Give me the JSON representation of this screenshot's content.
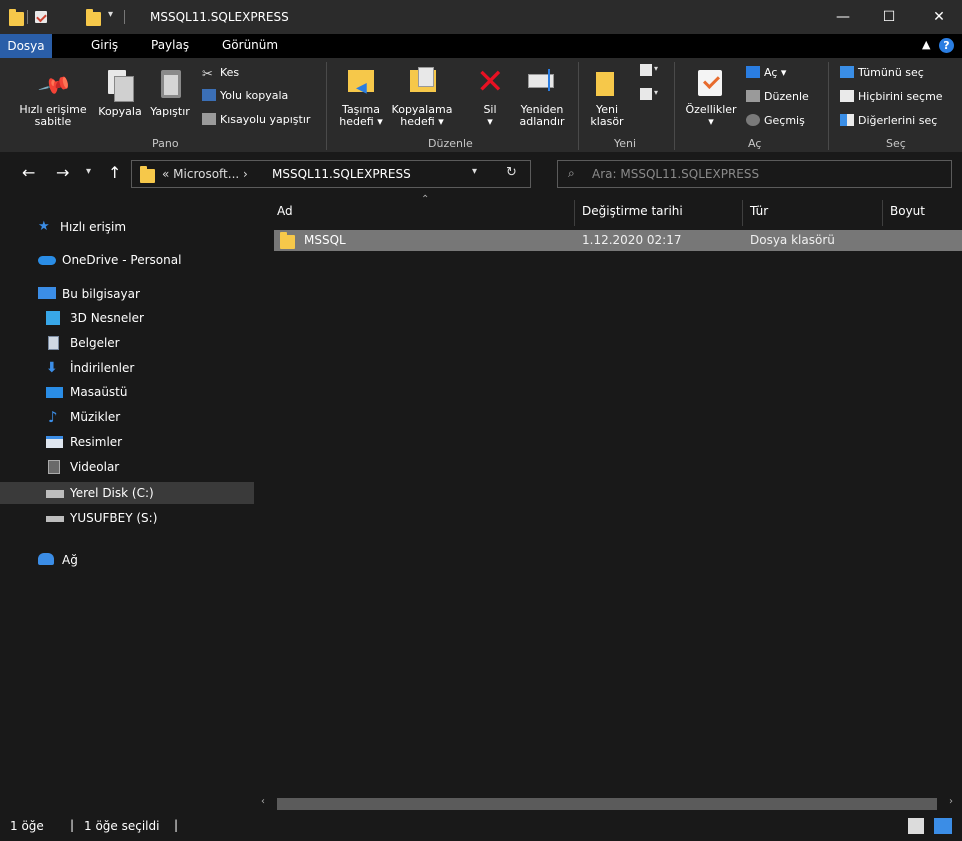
{
  "window": {
    "title": "MSSQL11.SQLEXPRESS",
    "controls": {
      "minimize": "—",
      "maximize": "☐",
      "close": "✕"
    }
  },
  "menu": {
    "tabs": [
      "Dosya",
      "Giriş",
      "Paylaş",
      "Görünüm"
    ],
    "active": "Dosya"
  },
  "ribbon": {
    "pano": {
      "group_label": "Pano",
      "pin_line1": "Hızlı erişime",
      "pin_line2": "sabitle",
      "copy": "Kopyala",
      "paste": "Yapıştır",
      "cut": "Kes",
      "copy_path": "Yolu kopyala",
      "paste_shortcut": "Kısayolu yapıştır"
    },
    "duzenle": {
      "group_label": "Düzenle",
      "move_line1": "Taşıma",
      "move_line2": "hedefi ▾",
      "copyto_line1": "Kopyalama",
      "copyto_line2": "hedefi ▾",
      "delete_line1": "Sil",
      "delete_line2": "▾",
      "rename_line1": "Yeniden",
      "rename_line2": "adlandır"
    },
    "yeni": {
      "group_label": "Yeni",
      "new_folder_line1": "Yeni",
      "new_folder_line2": "klasör"
    },
    "ac": {
      "group_label": "Aç",
      "properties_line1": "Özellikler",
      "properties_line2": "▾",
      "open": "Aç ▾",
      "edit": "Düzenle",
      "history": "Geçmiş"
    },
    "sec": {
      "group_label": "Seç",
      "select_all": "Tümünü seç",
      "select_none": "Hiçbirini seçme",
      "invert": "Diğerlerini seç"
    }
  },
  "address": {
    "prefix": "«  Microsoft...  ›",
    "current": "MSSQL11.SQLEXPRESS",
    "search_placeholder": "Ara: MSSQL11.SQLEXPRESS"
  },
  "nav": [
    {
      "label": "Hızlı erişim",
      "icon": "star-icon"
    },
    {
      "label": "OneDrive - Personal",
      "icon": "cloud-icon"
    },
    {
      "label": "Bu bilgisayar",
      "icon": "computer-icon"
    },
    {
      "label": "3D Nesneler",
      "icon": "cube-icon"
    },
    {
      "label": "Belgeler",
      "icon": "documents-icon"
    },
    {
      "label": "İndirilenler",
      "icon": "download-icon"
    },
    {
      "label": "Masaüstü",
      "icon": "desktop-icon"
    },
    {
      "label": "Müzikler",
      "icon": "music-icon"
    },
    {
      "label": "Resimler",
      "icon": "pictures-icon"
    },
    {
      "label": "Videolar",
      "icon": "video-icon"
    },
    {
      "label": "Yerel Disk (C:)",
      "icon": "drive-icon"
    },
    {
      "label": "YUSUFBEY (S:)",
      "icon": "drive-icon"
    },
    {
      "label": "Ağ",
      "icon": "network-icon"
    }
  ],
  "columns": [
    "Ad",
    "Değiştirme tarihi",
    "Tür",
    "Boyut"
  ],
  "files": [
    {
      "name": "MSSQL",
      "modified": "1.12.2020 02:17",
      "type": "Dosya klasörü",
      "size": ""
    }
  ],
  "status": {
    "count": "1 öğe",
    "selected": "1 öğe seçildi"
  },
  "colors": {
    "accent": "#2a5ea8",
    "folder": "#f6c84a",
    "selection": "#777777",
    "ribbon": "#2b2b2b",
    "background": "#191919"
  }
}
